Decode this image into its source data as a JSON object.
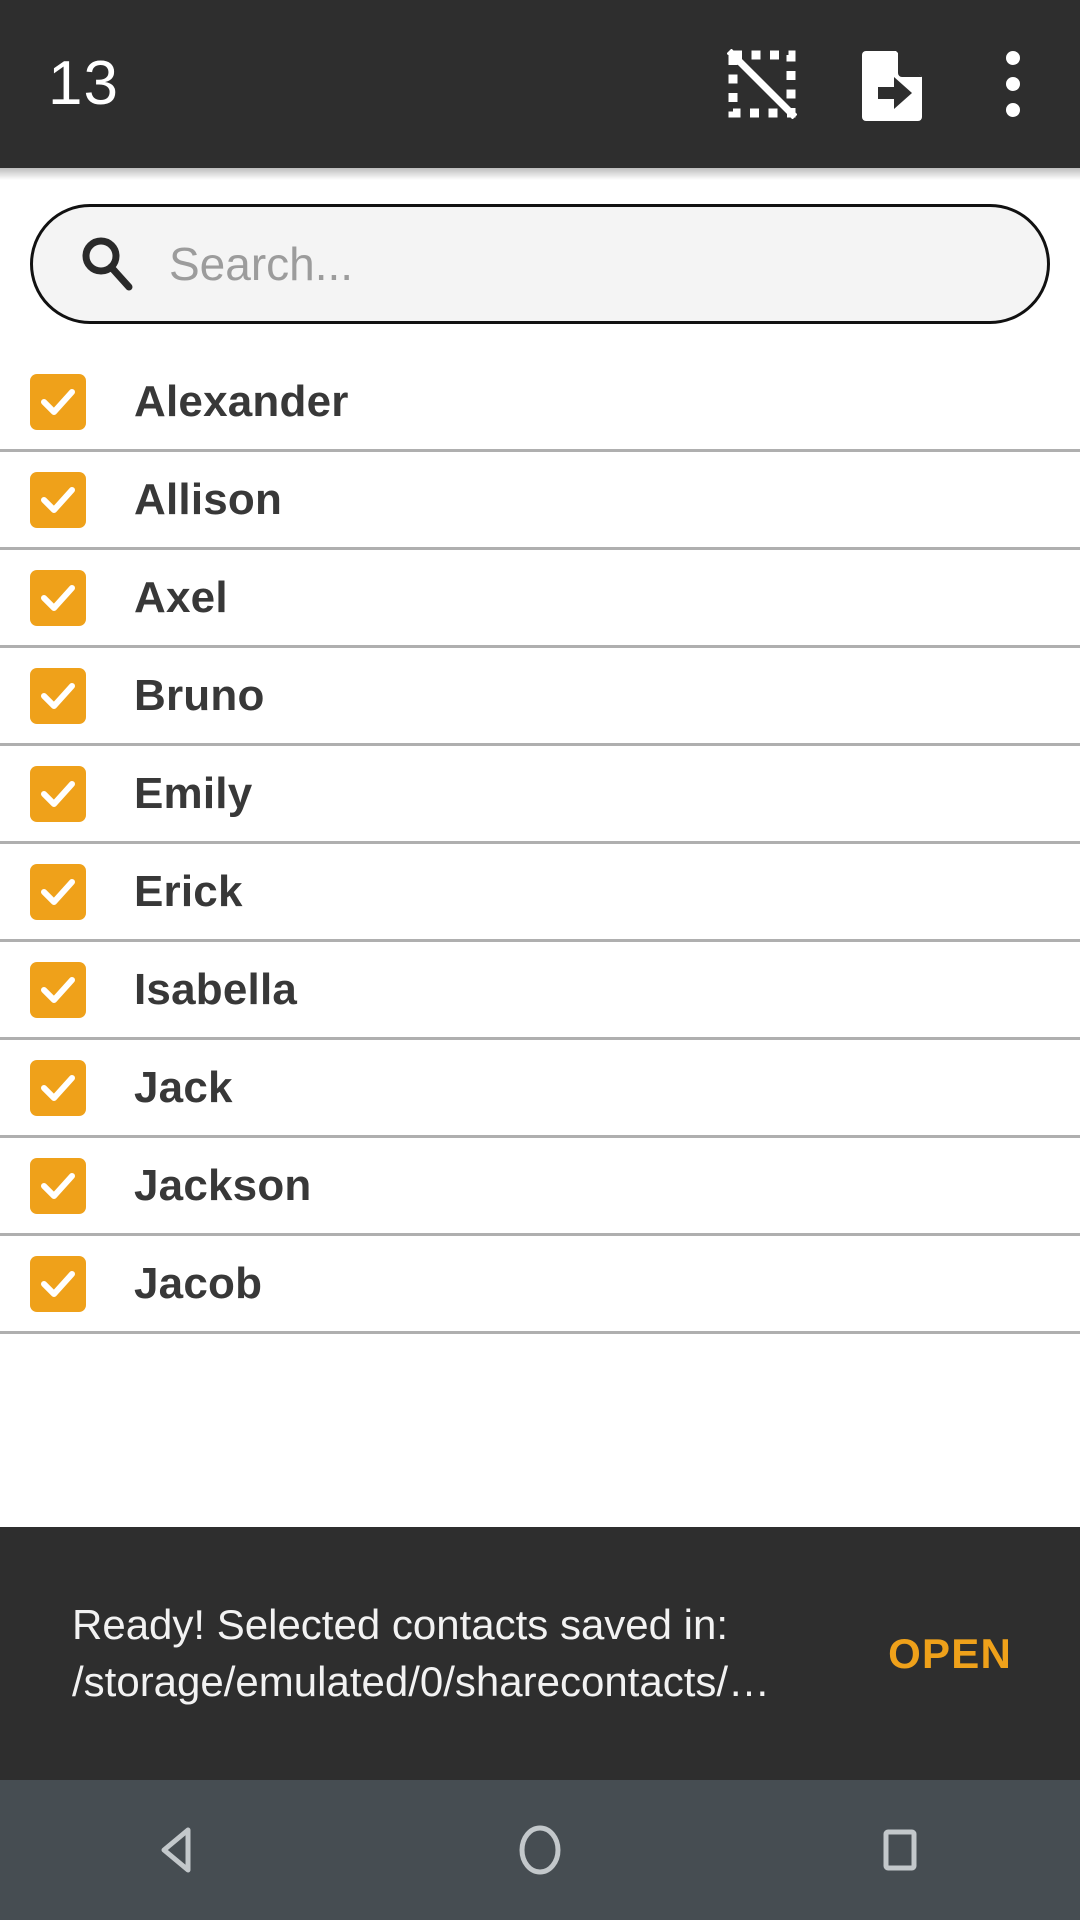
{
  "toolbar": {
    "selection_count": "13",
    "deselect_all_label": "deselect-all",
    "export_label": "export-file",
    "overflow_label": "more-options"
  },
  "search": {
    "value": "",
    "placeholder": "Search..."
  },
  "contacts": [
    {
      "name": "Alexander",
      "checked": true
    },
    {
      "name": "Allison",
      "checked": true
    },
    {
      "name": "Axel",
      "checked": true
    },
    {
      "name": "Bruno",
      "checked": true
    },
    {
      "name": "Emily",
      "checked": true
    },
    {
      "name": "Erick",
      "checked": true
    },
    {
      "name": "Isabella",
      "checked": true
    },
    {
      "name": "Jack",
      "checked": true
    },
    {
      "name": "Jackson",
      "checked": true
    },
    {
      "name": "Jacob",
      "checked": true
    }
  ],
  "snackbar": {
    "message": "Ready! Selected contacts saved in: /storage/emulated/0/sharecontacts/…",
    "action_label": "OPEN"
  },
  "navbar": {
    "back_label": "back",
    "home_label": "home",
    "recents_label": "recents"
  },
  "colors": {
    "toolbar_bg": "#2E2E2E",
    "accent_orange": "#EFA11A",
    "snackbar_bg": "#2E2E2E",
    "navbar_bg": "#464D52",
    "divider": "#AFAFAF",
    "name_text": "#383838",
    "placeholder_text": "#9C9C9C",
    "search_bg": "#F4F4F4"
  }
}
